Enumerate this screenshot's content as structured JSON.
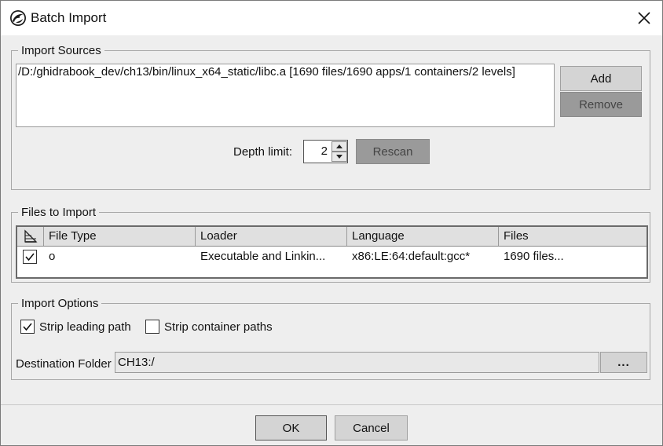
{
  "window": {
    "title": "Batch Import",
    "app_icon": "ghidra-dragon-icon",
    "close_icon": "close-icon"
  },
  "import_sources": {
    "legend": "Import Sources",
    "items": [
      "/D:/ghidrabook_dev/ch13/bin/linux_x64_static/libc.a [1690 files/1690 apps/1 containers/2 levels]"
    ],
    "add_label": "Add",
    "remove_label": "Remove",
    "depth_label": "Depth limit:",
    "depth_value": "2",
    "rescan_label": "Rescan"
  },
  "files_to_import": {
    "legend": "Files to Import",
    "columns": [
      "File Type",
      "Loader",
      "Language",
      "Files"
    ],
    "rows": [
      {
        "checked": true,
        "file_type": "o",
        "loader": "Executable and Linkin...",
        "language": "x86:LE:64:default:gcc*",
        "files": "1690 files..."
      }
    ]
  },
  "import_options": {
    "legend": "Import Options",
    "strip_leading_path": {
      "label": "Strip leading path",
      "checked": true
    },
    "strip_container_paths": {
      "label": "Strip container paths",
      "checked": false
    },
    "destination_label": "Destination Folder",
    "destination_value": "CH13:/",
    "browse_label": "..."
  },
  "footer": {
    "ok_label": "OK",
    "cancel_label": "Cancel"
  },
  "colors": {
    "window_bg": "#eeeeee",
    "disabled_button": "#9a9a9a",
    "button": "#d4d4d4"
  }
}
